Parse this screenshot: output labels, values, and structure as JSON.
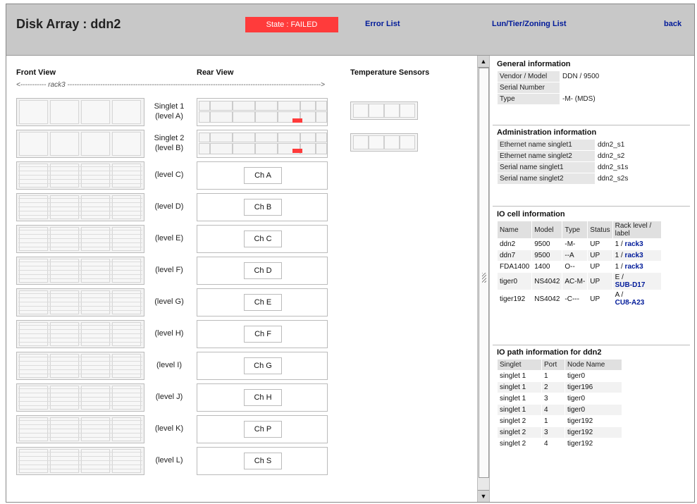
{
  "header": {
    "title": "Disk Array : ddn2",
    "state_label": "State : FAILED",
    "error_link": "Error List",
    "lun_link": "Lun/Tier/Zoning List",
    "back_link": "back",
    "state_color": "#ff3b3b"
  },
  "left": {
    "front_view": "Front View",
    "rear_view": "Rear View",
    "temperature": "Temperature Sensors",
    "rack_label": "rack3",
    "singlets": [
      {
        "name": "Singlet 1",
        "level": "(level A)"
      },
      {
        "name": "Singlet 2",
        "level": "(level B)"
      }
    ],
    "levels": [
      {
        "level": "(level C)",
        "channel": "Ch A"
      },
      {
        "level": "(level D)",
        "channel": "Ch B"
      },
      {
        "level": "(level E)",
        "channel": "Ch C"
      },
      {
        "level": "(level F)",
        "channel": "Ch D"
      },
      {
        "level": "(level G)",
        "channel": "Ch E"
      },
      {
        "level": "(level H)",
        "channel": "Ch F"
      },
      {
        "level": "(level I)",
        "channel": "Ch G"
      },
      {
        "level": "(level J)",
        "channel": "Ch H"
      },
      {
        "level": "(level K)",
        "channel": "Ch P"
      },
      {
        "level": "(level L)",
        "channel": "Ch S"
      }
    ]
  },
  "general": {
    "title": "General information",
    "rows": [
      {
        "key": "Vendor / Model",
        "value": "DDN / 9500"
      },
      {
        "key": "Serial Number",
        "value": ""
      },
      {
        "key": "Type",
        "value": "-M- (MDS)"
      }
    ]
  },
  "admin": {
    "title": "Administration information",
    "rows": [
      {
        "key": "Ethernet name singlet1",
        "value": "ddn2_s1"
      },
      {
        "key": "Ethernet name singlet2",
        "value": "ddn2_s2"
      },
      {
        "key": "Serial name singlet1",
        "value": "ddn2_s1s"
      },
      {
        "key": "Serial name singlet2",
        "value": "ddn2_s2s"
      }
    ]
  },
  "iocell": {
    "title": "IO cell information",
    "columns": [
      "Name",
      "Model",
      "Type",
      "Status",
      "Rack level / label"
    ],
    "rows": [
      {
        "name": "ddn2",
        "model": "9500",
        "type": "-M-",
        "status": "UP",
        "rack_level": "1 /",
        "rack_label": "rack3"
      },
      {
        "name": "ddn7",
        "model": "9500",
        "type": "--A",
        "status": "UP",
        "rack_level": "1 /",
        "rack_label": "rack3"
      },
      {
        "name": "FDA1400",
        "model": "1400",
        "type": "O--",
        "status": "UP",
        "rack_level": "1 /",
        "rack_label": "rack3"
      },
      {
        "name": "tiger0",
        "model": "NS4042",
        "type": "AC-M-",
        "status": "UP",
        "rack_level": "E /",
        "rack_label": "SUB-D17"
      },
      {
        "name": "tiger192",
        "model": "NS4042",
        "type": "-C---",
        "status": "UP",
        "rack_level": "A /",
        "rack_label": "CU8-A23"
      }
    ]
  },
  "iopath": {
    "title": "IO path information for ddn2",
    "columns": [
      "Singlet",
      "Port",
      "Node Name"
    ],
    "rows": [
      {
        "singlet": "singlet 1",
        "port": "1",
        "node": "tiger0"
      },
      {
        "singlet": "singlet 1",
        "port": "2",
        "node": "tiger196"
      },
      {
        "singlet": "singlet 1",
        "port": "3",
        "node": "tiger0"
      },
      {
        "singlet": "singlet 1",
        "port": "4",
        "node": "tiger0"
      },
      {
        "singlet": "singlet 2",
        "port": "1",
        "node": "tiger192"
      },
      {
        "singlet": "singlet 2",
        "port": "3",
        "node": "tiger192"
      },
      {
        "singlet": "singlet 2",
        "port": "4",
        "node": "tiger192"
      }
    ]
  }
}
